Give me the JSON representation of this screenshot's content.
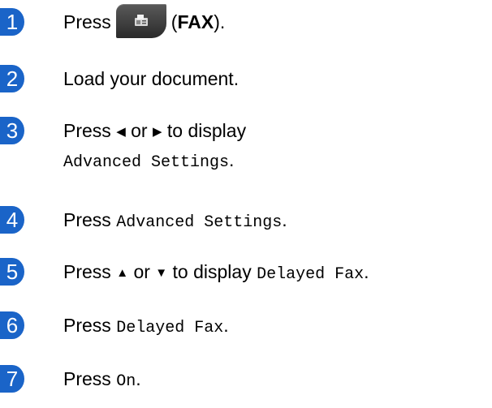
{
  "steps": [
    {
      "num": "1",
      "press": "Press",
      "paren_open": "(",
      "fax_label": "FAX",
      "paren_close": ")."
    },
    {
      "num": "2",
      "text": "Load your document."
    },
    {
      "num": "3",
      "press": "Press",
      "left_arrow": "◀",
      "or": "or",
      "right_arrow": "▶",
      "to_display": "to display",
      "ui_text": "Advanced Settings",
      "period": "."
    },
    {
      "num": "4",
      "press": "Press",
      "ui_text": "Advanced Settings",
      "period": "."
    },
    {
      "num": "5",
      "press": "Press",
      "up_arrow": "▲",
      "or": "or",
      "down_arrow": "▼",
      "to_display": "to display",
      "ui_text": "Delayed Fax",
      "period": "."
    },
    {
      "num": "6",
      "press": "Press",
      "ui_text": "Delayed Fax",
      "period": "."
    },
    {
      "num": "7",
      "press": "Press",
      "ui_text": "On",
      "period": "."
    }
  ],
  "icons": {
    "fax_button": "fax-machine-icon"
  },
  "colors": {
    "step_badge": "#1a64c8",
    "fax_button": "#3a3a3a"
  }
}
